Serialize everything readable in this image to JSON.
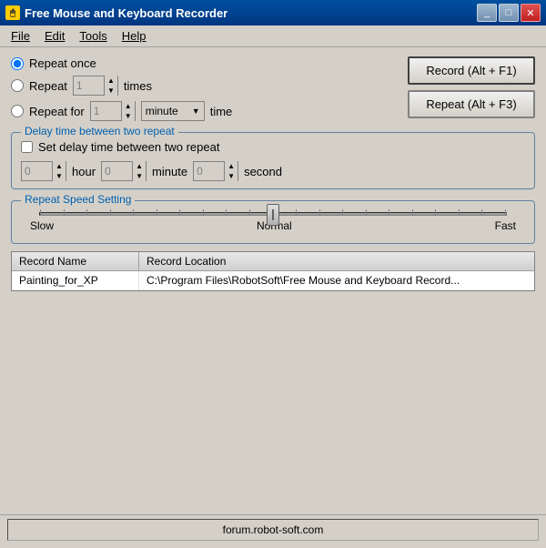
{
  "window": {
    "title": "Free Mouse and Keyboard Recorder",
    "icon": "🖱"
  },
  "title_buttons": {
    "minimize": "_",
    "maximize": "□",
    "close": "✕"
  },
  "menu": {
    "items": [
      "File",
      "Edit",
      "Tools",
      "Help"
    ]
  },
  "options": {
    "repeat_once_label": "Repeat once",
    "repeat_label": "Repeat",
    "repeat_for_label": "Repeat for",
    "times_label": "times",
    "time_label": "time",
    "repeat_value": "1",
    "repeat_for_value": "1",
    "minute_option": "minute"
  },
  "buttons": {
    "record_label": "Record (Alt + F1)",
    "repeat_label": "Repeat (Alt + F3)"
  },
  "delay_group": {
    "title": "Delay time between two repeat",
    "checkbox_label": "Set delay time between two repeat",
    "hour_label": "hour",
    "minute_label": "minute",
    "second_label": "second",
    "hour_value": "0",
    "minute_value": "0",
    "second_value": "0"
  },
  "speed_group": {
    "title": "Repeat Speed Setting",
    "slow_label": "Slow",
    "normal_label": "Normal",
    "fast_label": "Fast",
    "tick_count": 21
  },
  "table": {
    "headers": [
      "Record Name",
      "Record Location"
    ],
    "rows": [
      {
        "name": "Painting_for_XP",
        "location": "C:\\Program Files\\RobotSoft\\Free Mouse and Keyboard Record..."
      }
    ]
  },
  "status_bar": {
    "text": "forum.robot-soft.com"
  }
}
